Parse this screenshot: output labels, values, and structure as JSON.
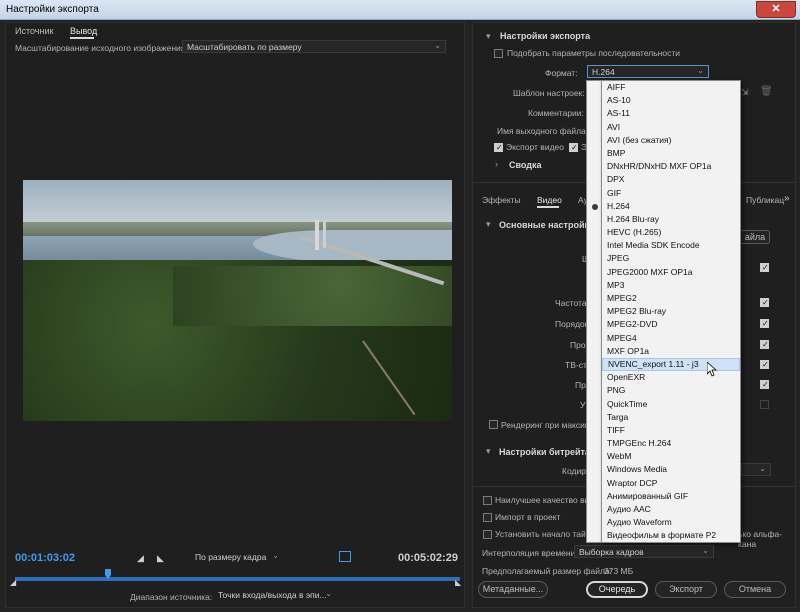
{
  "window": {
    "title": "Настройки экспорта",
    "close": "✕"
  },
  "left": {
    "tabs": [
      "Источник",
      "Вывод"
    ],
    "scale_label": "Масштабирование исходного изображения:",
    "scale_value": "Масштабировать по размеру",
    "timecode_start": "00:01:03:02",
    "timecode_end": "00:05:02:29",
    "fit_value": "По размеру кадра",
    "range_label": "Диапазон источника:",
    "range_value": "Точки входа/выхода в эпи..."
  },
  "right": {
    "section_title": "Настройки экспорта",
    "match_seq": "Подобрать параметры последовательности",
    "format_label": "Формат:",
    "format_value": "H.264",
    "preset_label": "Шаблон настроек:",
    "comments_label": "Комментарии:",
    "output_name_label": "Имя выходного файла:",
    "export_video": "Экспорт видео",
    "export_audio_partial": "Э",
    "summary": "Сводка",
    "tabs": [
      "Эффекты",
      "Видео",
      "Ау",
      "Публикац"
    ],
    "basic_settings": "Основные настройки",
    "match_source_partial": "айла",
    "rows_partial": [
      "Ш",
      "Частота",
      "Порядок",
      "Прог",
      "ТВ-ст",
      "Пр",
      "У"
    ],
    "render_max": "Рендеринг при максима",
    "bitrate_settings": "Настройки битрейта",
    "encoding_partial": "Кодир",
    "max_quality": "Наилучшее качество визу",
    "import_project": "Импорт в проект",
    "set_timecode": "Установить начало тайм-к",
    "alpha_partial": "ько альфа-кана",
    "time_interp_label": "Интерполяция времени:",
    "time_interp_value": "Выборка кадров",
    "est_size_label": "Предполагаемый размер файла:",
    "est_size_value": "373 МБ",
    "btn_metadata": "Метаданные...",
    "btn_queue": "Очередь",
    "btn_export": "Экспорт",
    "btn_cancel": "Отмена"
  },
  "format_options": [
    "AIFF",
    "AS-10",
    "AS-11",
    "AVI",
    "AVI (без сжатия)",
    "BMP",
    "DNxHR/DNxHD MXF OP1a",
    "DPX",
    "GIF",
    "H.264",
    "H.264 Blu-ray",
    "HEVC (H.265)",
    "Intel Media SDK Encode",
    "JPEG",
    "JPEG2000 MXF OP1a",
    "MP3",
    "MPEG2",
    "MPEG2 Blu-ray",
    "MPEG2-DVD",
    "MPEG4",
    "MXF OP1a",
    "NVENC_export 1.11 - j3",
    "OpenEXR",
    "PNG",
    "QuickTime",
    "Targa",
    "TIFF",
    "TMPGEnc H.264",
    "WebM",
    "Windows Media",
    "Wraptor DCP",
    "Анимированный GIF",
    "Аудио AAC",
    "Аудио Waveform",
    "Видеофильм в формате P2"
  ],
  "selected_format_index": 9,
  "hover_format_index": 21
}
